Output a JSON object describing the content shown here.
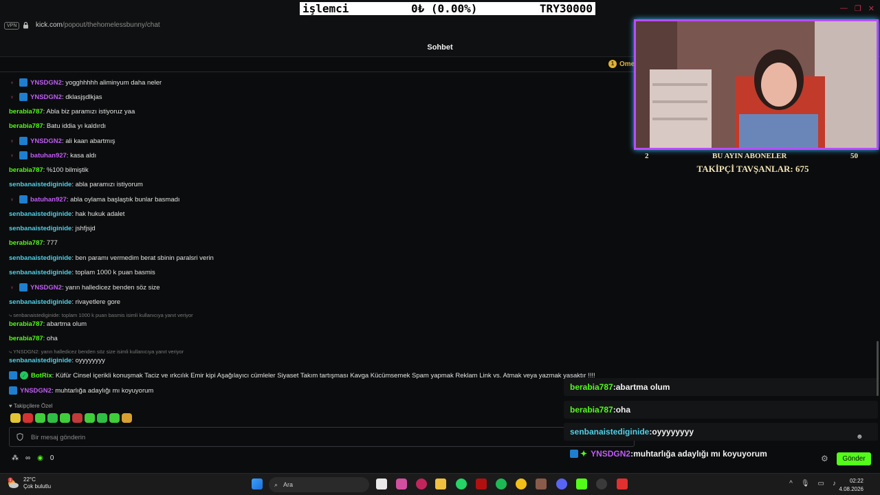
{
  "browser": {
    "vpn_label": "VPN",
    "url_host": "kick.com",
    "url_path": "/popout/thehomelessbunny/chat"
  },
  "ticker": {
    "name": "işlemci",
    "change": "0₺ (0.00%)",
    "amount": "TRY30000"
  },
  "chat": {
    "title": "Sohbet",
    "pinned_name": "Ome",
    "messages": [
      {
        "user": "YNSDGN2",
        "text": ": yogghhhhh aliminyum daha neler",
        "color": "purple",
        "badges": true
      },
      {
        "user": "YNSDGN2",
        "text": ": dklasjşdlkjas",
        "color": "purple",
        "badges": true
      },
      {
        "user": "berabia787",
        "text": ": Abla biz paramızı istiyoruz yaa",
        "color": "green",
        "badges": false
      },
      {
        "user": "berabia787",
        "text": ": Batu iddia yı kaldırdı",
        "color": "green",
        "badges": false
      },
      {
        "user": "YNSDGN2",
        "text": ": ali kaan abartmış",
        "color": "purple",
        "badges": true
      },
      {
        "user": "batuhan927",
        "text": ": kasa aldı",
        "color": "purple",
        "badges": true
      },
      {
        "user": "berabia787",
        "text": ": %100 bilmiştik",
        "color": "green",
        "badges": false
      },
      {
        "user": "senbanaistediginide",
        "text": ": abla paramızı istiyorum",
        "color": "cyan",
        "badges": false
      },
      {
        "user": "batuhan927",
        "text": ": abla oylama başlaştık bunlar basmadı",
        "color": "purple",
        "badges": true
      },
      {
        "user": "senbanaistediginide",
        "text": ": hak hukuk adalet",
        "color": "cyan",
        "badges": false
      },
      {
        "user": "senbanaistediginide",
        "text": ": jshfjsjd",
        "color": "cyan",
        "badges": false
      },
      {
        "user": "berabia787",
        "text": ": 777",
        "color": "green",
        "badges": false
      },
      {
        "user": "senbanaistediginide",
        "text": ": ben paramı vermedim berat sbinin paralsri verin",
        "color": "cyan",
        "badges": false
      },
      {
        "user": "senbanaistediginide",
        "text": ": toplam 1000 k puan basmis",
        "color": "cyan",
        "badges": false
      },
      {
        "user": "YNSDGN2",
        "text": ": yarın halledicez benden söz size",
        "color": "purple",
        "badges": true
      },
      {
        "user": "senbanaistediginide",
        "text": ": rivayetlere gore",
        "color": "cyan",
        "badges": false
      }
    ],
    "reply1": "senbanaistediginide: toplam 1000 k puan basmis isimli kullanıcıya yanıt veriyor",
    "msg_reply1": {
      "user": "berabia787",
      "text": ": abartma olum"
    },
    "msg_oha": {
      "user": "berabia787",
      "text": ": oha"
    },
    "reply2": "YNSDGN2: yarın halledicez benden söz size isimli kullanıcıya yanıt veriyor",
    "msg_reply2": {
      "user": "senbanaistediginide",
      "text": ": oyyyyyyyy"
    },
    "bot_msg": {
      "user": "BotRix",
      "text": ": Küfür Cinsel içerikli konuşmak Taciz ve ırkcılık Emir kipi Aşağılayıcı cümleler Siyaset Takım tartışması Kavga Kücümsemek Spam yapmak Reklam Link vs. Atmak veya yazmak yasaktır !!!!"
    },
    "last_msg": {
      "user": "YNSDGN2",
      "text": ": muhtarlığa adaylığı mı koyuyorum"
    },
    "followers_only": "Takipçilere Özel",
    "input_placeholder": "Bir mesaj gönderin",
    "points": "0",
    "send_label": "Gönder"
  },
  "stream_overlay": {
    "subs_title": "BU AYIN ABONELER",
    "subs_current": "2",
    "subs_goal": "50",
    "followers_text": "TAKİPÇİ TAVŞANLAR: 675",
    "chat": [
      {
        "user": "berabia787",
        "sep": " : ",
        "text": "abartma olum",
        "color": "#53fc18"
      },
      {
        "user": "berabia787",
        "sep": " : ",
        "text": "oha",
        "color": "#53fc18"
      },
      {
        "user": "senbanaistediginide",
        "sep": " : ",
        "text": "oyyyyyyyy",
        "color": "#4fd1e8"
      },
      {
        "user": "YNSDGN2",
        "sep": " : ",
        "text": "muhtarlığa adaylığı mı koyuyorum",
        "color": "#c05cf7"
      }
    ]
  },
  "taskbar": {
    "temperature": "22°C",
    "weather": "Çok bulutlu",
    "weather_badge": "1",
    "search_label": "Ara",
    "time": "02:22",
    "date": "4.08.2026"
  }
}
